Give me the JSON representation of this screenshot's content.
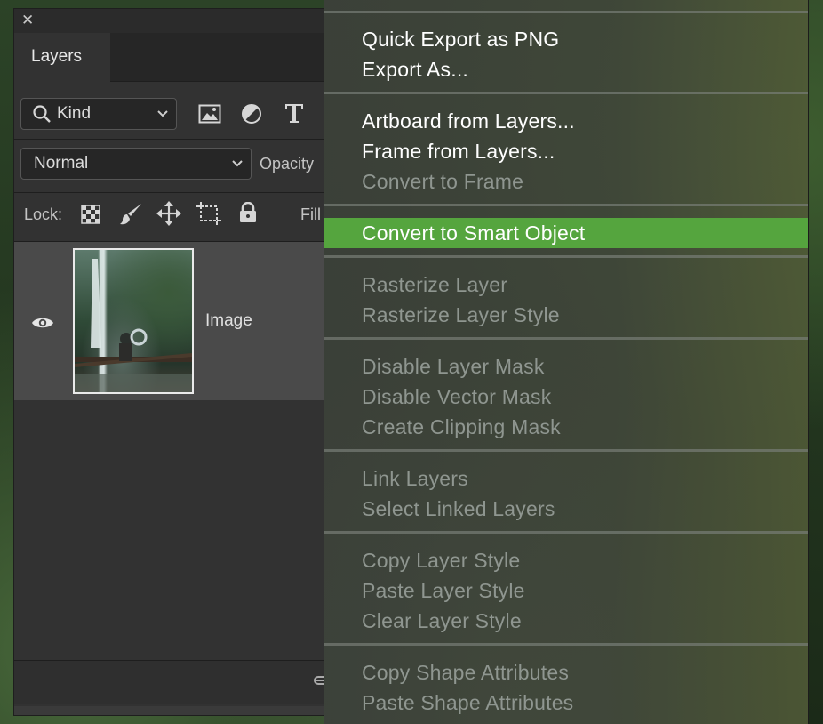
{
  "layers_panel": {
    "tab_label": "Layers",
    "close_glyph": "✕",
    "filter": {
      "value": "Kind"
    },
    "blend_mode": {
      "value": "Normal"
    },
    "opacity_label": "Opacity",
    "lock_label": "Lock:",
    "fill_label": "Fill",
    "layer": {
      "name": "Image",
      "visible": true
    }
  },
  "context_menu": {
    "items": [
      {
        "label": "Quick Export as PNG",
        "enabled": true
      },
      {
        "label": "Export As...",
        "enabled": true
      },
      {
        "label": "Artboard from Layers...",
        "enabled": true
      },
      {
        "label": "Frame from Layers...",
        "enabled": true
      },
      {
        "label": "Convert to Frame",
        "enabled": false
      },
      {
        "label": "Convert to Smart Object",
        "enabled": true,
        "highlighted": true
      },
      {
        "label": "Rasterize Layer",
        "enabled": false
      },
      {
        "label": "Rasterize Layer Style",
        "enabled": false
      },
      {
        "label": "Disable Layer Mask",
        "enabled": false
      },
      {
        "label": "Disable Vector Mask",
        "enabled": false
      },
      {
        "label": "Create Clipping Mask",
        "enabled": false
      },
      {
        "label": "Link Layers",
        "enabled": false
      },
      {
        "label": "Select Linked Layers",
        "enabled": false
      },
      {
        "label": "Copy Layer Style",
        "enabled": false
      },
      {
        "label": "Paste Layer Style",
        "enabled": false
      },
      {
        "label": "Clear Layer Style",
        "enabled": false
      },
      {
        "label": "Copy Shape Attributes",
        "enabled": false
      },
      {
        "label": "Paste Shape Attributes",
        "enabled": false
      }
    ]
  },
  "colors": {
    "highlight": "#55a53e",
    "panel_bg": "#323232",
    "disabled_text": "#8f9690"
  }
}
